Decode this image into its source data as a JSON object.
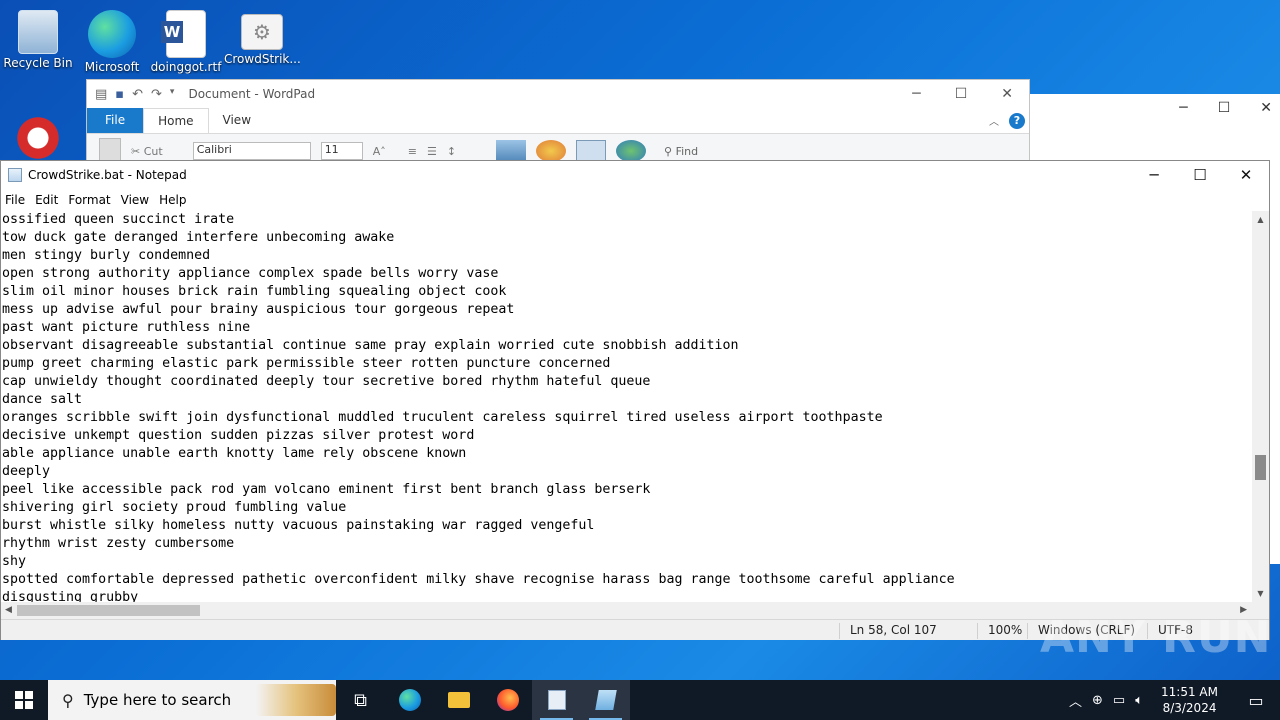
{
  "desktop": {
    "icons": [
      {
        "label": "Recycle Bin"
      },
      {
        "label": "Microsoft"
      },
      {
        "label": "doinggot.rtf"
      },
      {
        "label": "CrowdStrik..."
      }
    ]
  },
  "wordpad": {
    "title": "Document - WordPad",
    "tabs": {
      "file": "File",
      "home": "Home",
      "view": "View"
    },
    "ribbon": {
      "cut": "Cut",
      "font": "Calibri",
      "size": "11",
      "find": "Find"
    }
  },
  "notepad": {
    "title": "CrowdStrike.bat - Notepad",
    "menu": [
      "File",
      "Edit",
      "Format",
      "View",
      "Help"
    ],
    "lines": [
      "ossified queen succinct irate",
      "tow duck gate deranged interfere unbecoming awake",
      "men stingy burly condemned",
      "open strong authority appliance complex spade bells worry vase",
      "slim oil minor houses brick rain fumbling squealing object cook",
      "mess up advise awful pour brainy auspicious tour gorgeous repeat",
      "past want picture ruthless nine",
      "observant disagreeable substantial continue same pray explain worried cute snobbish addition",
      "pump greet charming elastic park permissible steer rotten puncture concerned",
      "cap unwieldy thought coordinated deeply tour secretive bored rhythm hateful queue",
      "dance salt",
      "oranges scribble swift join dysfunctional muddled truculent careless squirrel tired useless airport toothpaste",
      "decisive unkempt question sudden pizzas silver protest word",
      "able appliance unable earth knotty lame rely obscene known",
      "deeply",
      "peel like accessible pack rod yam volcano eminent first bent branch glass berserk",
      "shivering girl society proud fumbling value",
      "burst whistle silky homeless nutty vacuous painstaking war ragged vengeful",
      "rhythm wrist zesty cumbersome",
      "shy",
      "spotted comfortable depressed pathetic overconfident milky shave recognise harass bag range toothsome careful appliance",
      "disgusting grubby"
    ],
    "status": {
      "position": "Ln 58, Col 107",
      "zoom": "100%",
      "line_ending": "Windows (CRLF)",
      "encoding": "UTF-8"
    }
  },
  "watermark": "ANY RUN",
  "taskbar": {
    "search_placeholder": "Type here to search",
    "time": "11:51 AM",
    "date": "8/3/2024"
  }
}
